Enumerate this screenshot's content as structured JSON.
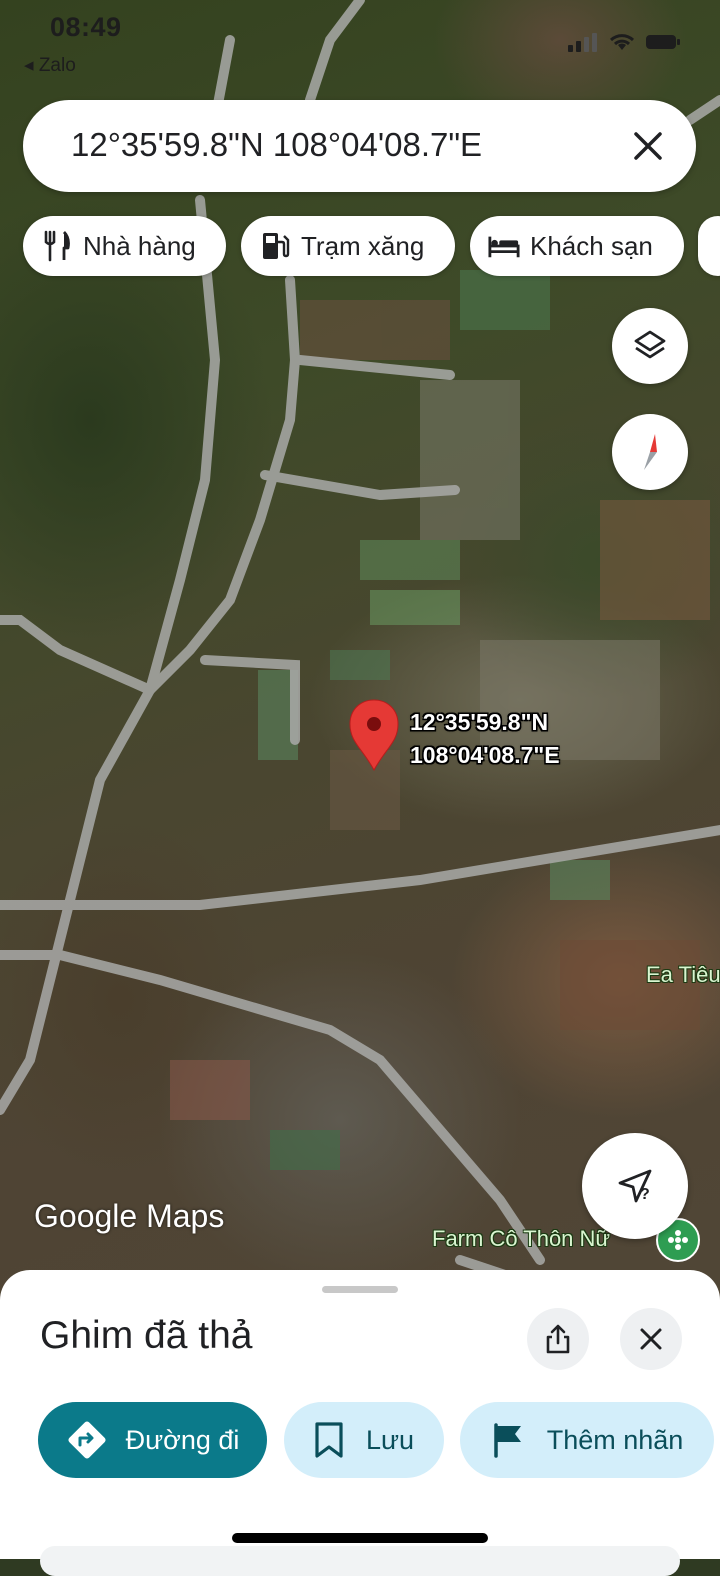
{
  "status_bar": {
    "time": "08:49",
    "back_label": "◂ Zalo"
  },
  "search": {
    "query": "12°35'59.8\"N 108°04'08.7\"E"
  },
  "chips": [
    {
      "label": "Nhà hàng",
      "icon": "restaurant-icon"
    },
    {
      "label": "Trạm xăng",
      "icon": "gas-station-icon"
    },
    {
      "label": "Khách sạn",
      "icon": "hotel-icon"
    }
  ],
  "map": {
    "pin_coord_line1": "12°35'59.8\"N",
    "pin_coord_line2": "108°04'08.7\"E",
    "place_labels": [
      "Ea Tiêu",
      "Farm Cô Thôn Nữ"
    ],
    "logo_google": "Google",
    "logo_maps": "Maps",
    "pin_color": "#e53935"
  },
  "sheet": {
    "title": "Ghim đã thả",
    "actions": [
      {
        "label": "Đường đi",
        "icon": "directions-icon"
      },
      {
        "label": "Lưu",
        "icon": "bookmark-icon"
      },
      {
        "label": "Thêm nhãn",
        "icon": "flag-icon"
      }
    ]
  },
  "colors": {
    "accent": "#0b7a8a",
    "secondary_bg": "#d3eefa",
    "pin": "#e53935"
  }
}
